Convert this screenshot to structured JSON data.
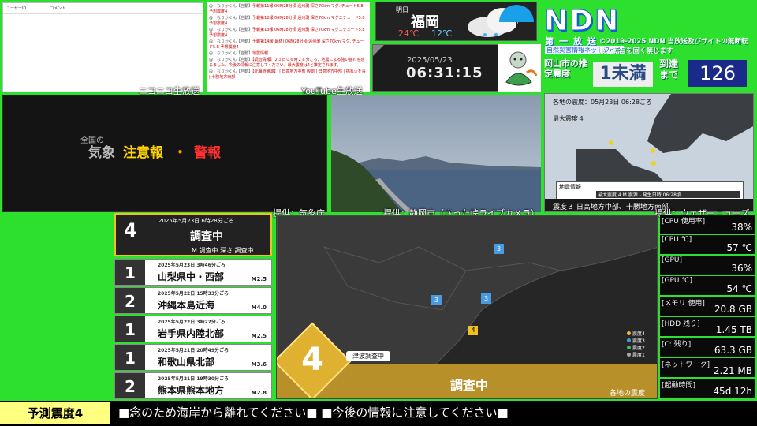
{
  "niconico": {
    "col1": "ユーザーID",
    "col2": "コメント",
    "label": "ニコニコ生放送"
  },
  "youtube": {
    "label": "YouTube生放送",
    "rows": [
      {
        "u": "@：なりかくん【自動】",
        "t": "予報第11報 06時28分頃 遠州灘 深さ70km マグ. チュード5.8 予想震度4"
      },
      {
        "u": "@：なりかくん【自動】",
        "t": "予報第12報 06時28分頃 遠州灘 深さ70km マグニチュード5.8 予想震度4"
      },
      {
        "u": "@：なりかくん【自動】",
        "t": "予報第13報 06時28分頃 遠州灘 深さ70km マグニチュード5.8 予想震度4"
      },
      {
        "u": "@：なりかくん【自動】",
        "t": "予報第14報(最終) 06時28分頃 遠州灘 深さ70km マグ. チュード5.8 予想震度4"
      },
      {
        "u": "@：なりかくん【自動】",
        "t": "地震情報"
      },
      {
        "u": "@：なりかくん【自動】",
        "t": "【調査情報】２３日０６時２８分ころ、地震による強い揺れを感じました。今後の情報に注意してください。最大震度は4と推定されます。"
      },
      {
        "u": "@：なりかくん【自動】",
        "t": "【北海道観測】 | 日高地方中部 観測 | 日高地方中部 | 揺れ火を事 | 十勝地方南部"
      }
    ]
  },
  "weather": {
    "tag": "明日",
    "city": "福岡",
    "high": "24℃",
    "low": "12℃"
  },
  "clock": {
    "date": "2025/05/23",
    "time": "06:31:15"
  },
  "brand": {
    "name": "NDN",
    "sub": "第一放送",
    "sub2": "自然災害情報ネットワーク",
    "copyright": "©2019-2025 NDN 当放送及びサイトの無断転載・転写を固く禁じます"
  },
  "estimate": {
    "label": "岡山市の推定震度",
    "value": "1未満",
    "arrival_label": "到達まで",
    "arrival": "126"
  },
  "warning": {
    "pre": "全国の",
    "kisho": "気象",
    "chui": "注意報",
    "dot": "・",
    "keiho": "警報"
  },
  "sources": {
    "jma": "提供：気象庁",
    "camera": "提供：静岡市（さった峠ライブカメラ）",
    "weathernews": "提供：ウェザーニューズ"
  },
  "info_map": {
    "header": "各地の震度：05月23日 06:28ごろ",
    "max": "最大震度４",
    "box_title": "地震情報",
    "bar": "最大震度 4 M  震源 -  発生日時 06:28頃",
    "bottom": "震度３  日高地方中部、十勝地方南部"
  },
  "quake_top": {
    "intensity": "4",
    "datetime": "2025年5月23日 6時28分ごろ",
    "place": "調査中",
    "detail": "M 調査中  深さ 調査中"
  },
  "quakes": [
    {
      "intensity": "1",
      "datetime": "2025年5月23日 3時46分ごろ",
      "place": "山梨県中・西部",
      "mag": "M2.5",
      "color": "#ffffff"
    },
    {
      "intensity": "2",
      "datetime": "2025年5月22日 15時33分ごろ",
      "place": "沖縄本島近海",
      "mag": "M4.0",
      "color": "#ffffff"
    },
    {
      "intensity": "1",
      "datetime": "2025年5月22日 3時27分ごろ",
      "place": "岩手県内陸北部",
      "mag": "M2.5",
      "color": "#ffffff"
    },
    {
      "intensity": "1",
      "datetime": "2025年5月21日 20時49分ごろ",
      "place": "和歌山県北部",
      "mag": "M3.6",
      "color": "#ffffff"
    },
    {
      "intensity": "2",
      "datetime": "2025年5月21日 19時30分ごろ",
      "place": "熊本県熊本地方",
      "mag": "M2.8",
      "color": "#ffffff"
    }
  ],
  "big_map": {
    "intensity": "4",
    "tsunami": "津波調査中",
    "status": "調査中",
    "footer": "各地の震度",
    "legend": [
      "震度4",
      "震度3",
      "震度2",
      "震度1"
    ],
    "legend_colors": [
      "#f0c020",
      "#4a9ae0",
      "#40c060",
      "#aaaaaa"
    ],
    "marker3": "3",
    "marker4": "4"
  },
  "stats": [
    {
      "k": "[CPU 使用率]",
      "v": "38%"
    },
    {
      "k": "[CPU ℃]",
      "v": "57 ℃"
    },
    {
      "k": "[GPU]",
      "v": "36%"
    },
    {
      "k": "[GPU ℃]",
      "v": "54 ℃"
    },
    {
      "k": "[メモリ 使用]",
      "v": "20.8 GB"
    },
    {
      "k": "[HDD 残り]",
      "v": "1.45 TB"
    },
    {
      "k": "[C: 残り]",
      "v": "63.3 GB"
    },
    {
      "k": "[ネットワーク]",
      "v": "2.21 MB"
    },
    {
      "k": "[起動時間]",
      "v": "45d 12h"
    }
  ],
  "footer": {
    "left": "予測震度4",
    "msg": "■念のため海岸から離れてください■      ■今後の情報に注意してください■"
  }
}
